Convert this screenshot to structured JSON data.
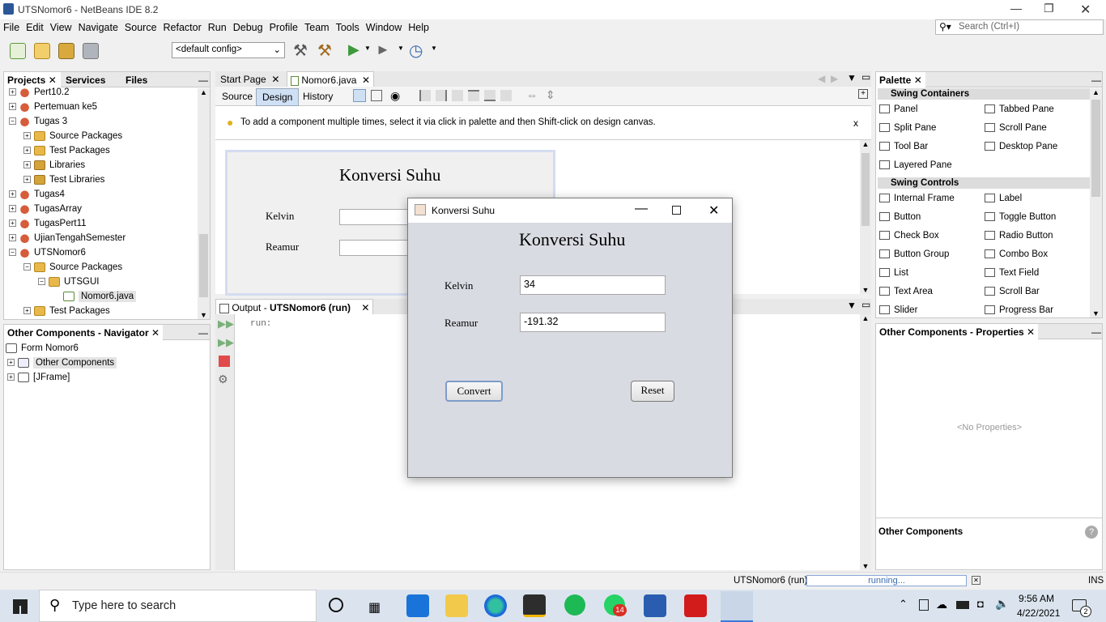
{
  "window": {
    "title": "UTSNomor6 - NetBeans IDE 8.2"
  },
  "menu": [
    "File",
    "Edit",
    "View",
    "Navigate",
    "Source",
    "Refactor",
    "Run",
    "Debug",
    "Profile",
    "Team",
    "Tools",
    "Window",
    "Help"
  ],
  "search": {
    "placeholder": "Search (Ctrl+I)"
  },
  "toolbar": {
    "config": "<default config>"
  },
  "projects": {
    "tabs": [
      "Projects",
      "Services",
      "Files"
    ],
    "tree": [
      {
        "label": "Pert10.2",
        "indent": 0,
        "icon": "coffee"
      },
      {
        "label": "Pertemuan ke5",
        "indent": 0,
        "icon": "coffee"
      },
      {
        "label": "Tugas 3",
        "indent": 0,
        "icon": "coffee"
      },
      {
        "label": "Source Packages",
        "indent": 1,
        "icon": "folder"
      },
      {
        "label": "Test Packages",
        "indent": 1,
        "icon": "folder"
      },
      {
        "label": "Libraries",
        "indent": 1,
        "icon": "lib"
      },
      {
        "label": "Test Libraries",
        "indent": 1,
        "icon": "lib"
      },
      {
        "label": "Tugas4",
        "indent": 0,
        "icon": "coffee"
      },
      {
        "label": "TugasArray",
        "indent": 0,
        "icon": "coffee"
      },
      {
        "label": "TugasPert11",
        "indent": 0,
        "icon": "coffee"
      },
      {
        "label": "UjianTengahSemester",
        "indent": 0,
        "icon": "coffee"
      },
      {
        "label": "UTSNomor6",
        "indent": 0,
        "icon": "coffee"
      },
      {
        "label": "Source Packages",
        "indent": 1,
        "icon": "folder"
      },
      {
        "label": "UTSGUI",
        "indent": 2,
        "icon": "folder"
      },
      {
        "label": "Nomor6.java",
        "indent": 3,
        "icon": "java"
      },
      {
        "label": "Test Packages",
        "indent": 1,
        "icon": "folder"
      }
    ]
  },
  "navigator": {
    "title": "Other Components - Navigator",
    "items": [
      "Form Nomor6",
      "Other Components",
      "[JFrame]"
    ]
  },
  "editor": {
    "tabs": [
      "Start Page",
      "Nomor6.java"
    ],
    "modes": [
      "Source",
      "Design",
      "History"
    ],
    "hint": "To add a component multiple times, select it via click in palette and then Shift-click on design canvas.",
    "hint_close": "x",
    "form_title": "Konversi Suhu",
    "form_labels": [
      "Kelvin",
      "Reamur"
    ]
  },
  "output": {
    "title_prefix": "Output - ",
    "title_bold": "UTSNomor6 (run)",
    "text": "run:"
  },
  "palette": {
    "title": "Palette",
    "sections": [
      {
        "name": "Swing Containers",
        "items": [
          "Panel",
          "Tabbed Pane",
          "Split Pane",
          "Scroll Pane",
          "Tool Bar",
          "Desktop Pane",
          "Layered Pane"
        ]
      },
      {
        "name": "Swing Controls",
        "items": [
          "Internal Frame",
          "Label",
          "Button",
          "Toggle Button",
          "Check Box",
          "Radio Button",
          "Button Group",
          "Combo Box",
          "List",
          "Text Field",
          "Text Area",
          "Scroll Bar",
          "Slider",
          "Progress Bar"
        ]
      }
    ]
  },
  "properties": {
    "title": "Other Components - Properties",
    "empty": "<No Properties>",
    "footer": "Other Components"
  },
  "status": {
    "project": "UTSNomor6 (run)",
    "progress": "running...",
    "mode": "INS"
  },
  "dialog": {
    "title": "Konversi Suhu",
    "heading": "Konversi Suhu",
    "kelvin_label": "Kelvin",
    "kelvin_value": "34",
    "reamur_label": "Reamur",
    "reamur_value": "-191.32",
    "convert": "Convert",
    "reset": "Reset"
  },
  "taskbar": {
    "search": "Type here to search",
    "time": "9:56 AM",
    "date": "4/22/2021",
    "whatsapp_badge": "14",
    "notif_badge": "2"
  }
}
